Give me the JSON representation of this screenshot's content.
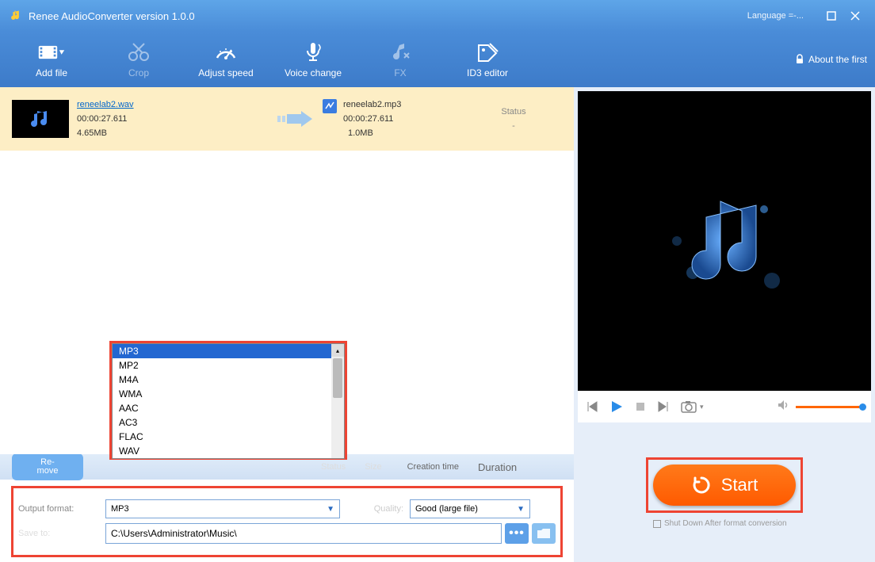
{
  "title": "Renee AudioConverter version 1.0.0",
  "language": "Language =-...",
  "about": "About the first",
  "toolbar": {
    "add_file": "Add file",
    "crop": "Crop",
    "adjust_speed": "Adjust speed",
    "voice_change": "Voice change",
    "fx": "FX",
    "id3": "ID3 editor"
  },
  "file": {
    "in_name": "reneelab2.wav",
    "in_time": "00:00:27.611",
    "in_size": "4.65MB",
    "out_name": "reneelab2.mp3",
    "out_time": "00:00:27.611",
    "out_size": "1.0MB",
    "status_label": "Status",
    "status_value": "-"
  },
  "bottom": {
    "remove": "Re-\nmove",
    "col1": "Status",
    "col2": "Size",
    "creation": "Creation time",
    "duration": "Duration"
  },
  "dropdown": {
    "options": [
      "MP3",
      "MP2",
      "M4A",
      "WMA",
      "AAC",
      "AC3",
      "FLAC",
      "WAV"
    ]
  },
  "output": {
    "format_label": "Output format:",
    "format_value": "MP3",
    "quality_label": "Quality:",
    "quality_value": "Good (large file)",
    "save_to_label": "Save to:",
    "path": "C:\\Users\\Administrator\\Music\\"
  },
  "start": "Start",
  "shutdown": "Shut Down After format conversion"
}
